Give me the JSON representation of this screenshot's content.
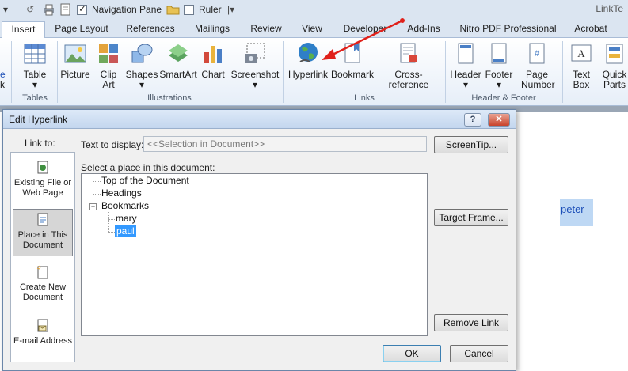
{
  "qat": {
    "nav_pane_label": "Navigation Pane",
    "ruler_label": "Ruler",
    "app_title_partial": "LinkTe"
  },
  "tabs": [
    "Insert",
    "Page Layout",
    "References",
    "Mailings",
    "Review",
    "View",
    "Developer",
    "Add-Ins",
    "Nitro PDF Professional",
    "Acrobat"
  ],
  "ribbon": {
    "partial_left": [
      "e",
      "k"
    ],
    "buttons": {
      "table": "Table",
      "picture": "Picture",
      "clip_art": "Clip Art",
      "shapes": "Shapes",
      "smartart": "SmartArt",
      "chart": "Chart",
      "screenshot": "Screenshot",
      "hyperlink": "Hyperlink",
      "bookmark": "Bookmark",
      "cross_reference": "Cross-reference",
      "header": "Header",
      "footer": "Footer",
      "page_number": "Page Number",
      "text_box": "Text Box",
      "quick_parts": "Quick Parts"
    },
    "groups": {
      "tables": "Tables",
      "illustrations": "Illustrations",
      "links": "Links",
      "header_footer": "Header & Footer"
    },
    "arrow_color": "#e0211b"
  },
  "document": {
    "link_text": "peter"
  },
  "dialog": {
    "title": "Edit Hyperlink",
    "help_glyph": "?",
    "close_glyph": "✕",
    "link_to_label": "Link to:",
    "link_options": [
      {
        "label": "Existing File or Web Page",
        "selected": false
      },
      {
        "label": "Place in This Document",
        "selected": true
      },
      {
        "label": "Create New Document",
        "selected": false
      },
      {
        "label": "E-mail Address",
        "selected": false
      }
    ],
    "text_to_display_label": "Text to display:",
    "text_to_display_value": "<<Selection in Document>>",
    "screentip_button": "ScreenTip...",
    "select_place_label": "Select a place in this document:",
    "tree": {
      "top": "Top of the Document",
      "headings": "Headings",
      "bookmarks": "Bookmarks",
      "children": [
        "mary",
        "paul"
      ],
      "selected": "paul"
    },
    "target_frame_button": "Target Frame...",
    "remove_link_button": "Remove Link",
    "ok_button": "OK",
    "cancel_button": "Cancel"
  }
}
